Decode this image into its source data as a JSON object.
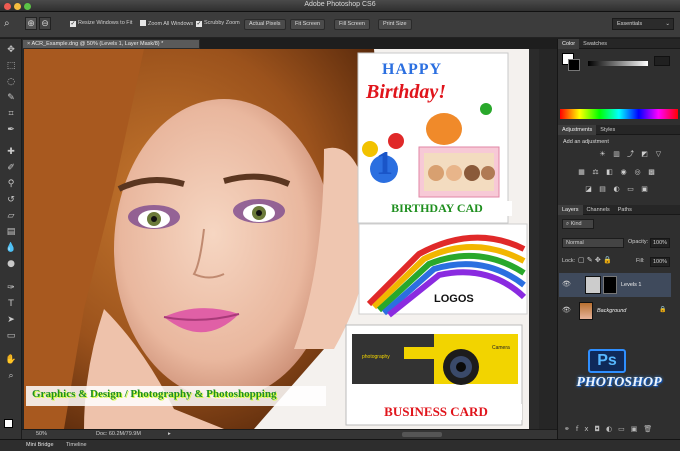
{
  "window": {
    "title": "Adobe Photoshop CS6"
  },
  "options_bar": {
    "checkboxes": [
      {
        "label": "Resize Windows to Fit"
      },
      {
        "label": "Zoom All Windows"
      },
      {
        "label": "Scrubby Zoom"
      }
    ],
    "buttons": [
      "Actual Pixels",
      "Fit Screen",
      "Fill Screen",
      "Print Size"
    ],
    "workspace": "Essentials"
  },
  "document": {
    "tab_title": "ACR_Example.dng @ 50% (Levels 1, Layer Mask/8) *",
    "zoom": "50%",
    "doc_size": "Doc: 60.2M/79.9M"
  },
  "bottom_tabs": [
    "Mini Bridge",
    "Timeline"
  ],
  "color_panel": {
    "tabs": [
      "Color",
      "Swatches"
    ]
  },
  "adjustments_panel": {
    "tabs": [
      "Adjustments",
      "Styles"
    ],
    "heading": "Add an adjustment"
  },
  "layers_panel": {
    "tabs": [
      "Layers",
      "Channels",
      "Paths"
    ],
    "kind": "Kind",
    "blend_mode": "Normal",
    "opacity_label": "Opacity:",
    "opacity": "100%",
    "lock_label": "Lock:",
    "fill_label": "Fill:",
    "fill": "100%",
    "layers": [
      {
        "name": "Levels 1",
        "italic": false
      },
      {
        "name": "Background",
        "italic": true
      }
    ]
  },
  "artwork": {
    "birthday_top": "HAPPY",
    "birthday_bottom": "Birthday!",
    "birthday_number": "1",
    "birthday_card": "BIRTHDAY CAD",
    "logos": "LOGOS",
    "business_card": "BUSINESS CARD",
    "tagline": "Graphics & Design / Photography & Photoshopping",
    "ps_badge": "Ps",
    "ps_logo": "PHOTOSHOP",
    "bc_left": "photography",
    "bc_right": "Camera"
  },
  "colors": {
    "accent_blue": "#1a6fd6",
    "panel_dark": "#2f2f2f",
    "banner_red": "#e0141b",
    "banner_green": "#1f8f1f"
  }
}
